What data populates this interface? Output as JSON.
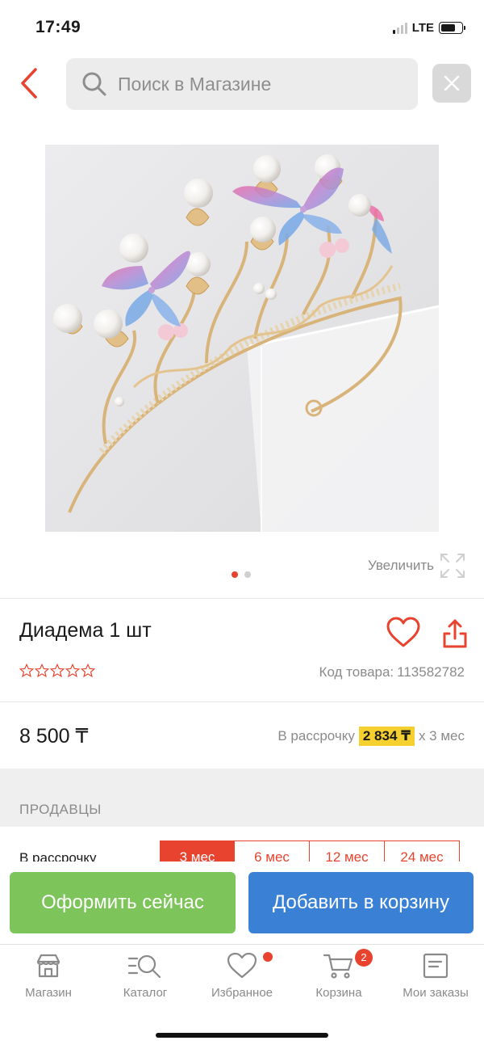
{
  "status_bar": {
    "time": "17:49",
    "network": "LTE",
    "battery_level": 0.75
  },
  "header": {
    "search_placeholder": "Поиск в Магазине",
    "icons": {
      "back": "chevron-left-icon",
      "search": "search-icon",
      "clear": "close-icon"
    }
  },
  "gallery": {
    "zoom_label": "Увеличить",
    "page_count": 2,
    "active_page": 1
  },
  "product": {
    "title": "Диадема 1 шт",
    "rating": 0,
    "code_label": "Код товара:",
    "code_value": "113582782",
    "price": "8 500 ₸",
    "installment_prefix": "В рассрочку",
    "installment_amount": "2 834 ₸",
    "installment_suffix": "x 3 мес"
  },
  "sellers": {
    "label": "ПРОДАВЦЫ",
    "installment_label": "В рассрочку",
    "terms": [
      "3 мес",
      "6 мес",
      "12 мес",
      "24 мес"
    ],
    "selected_term": "3 мес"
  },
  "actions": {
    "checkout": "Оформить сейчас",
    "add_to_cart": "Добавить в корзину"
  },
  "tabbar": {
    "items": [
      {
        "label": "Магазин",
        "icon": "store-icon"
      },
      {
        "label": "Каталог",
        "icon": "catalog-search-icon"
      },
      {
        "label": "Избранное",
        "icon": "heart-icon"
      },
      {
        "label": "Корзина",
        "icon": "cart-icon"
      },
      {
        "label": "Мои заказы",
        "icon": "orders-icon"
      }
    ],
    "cart_badge": "2"
  },
  "colors": {
    "accent_red": "#e8432e",
    "checkout_green": "#7dc45a",
    "cart_blue": "#3a81d6",
    "installment_highlight": "#f5d02f"
  }
}
